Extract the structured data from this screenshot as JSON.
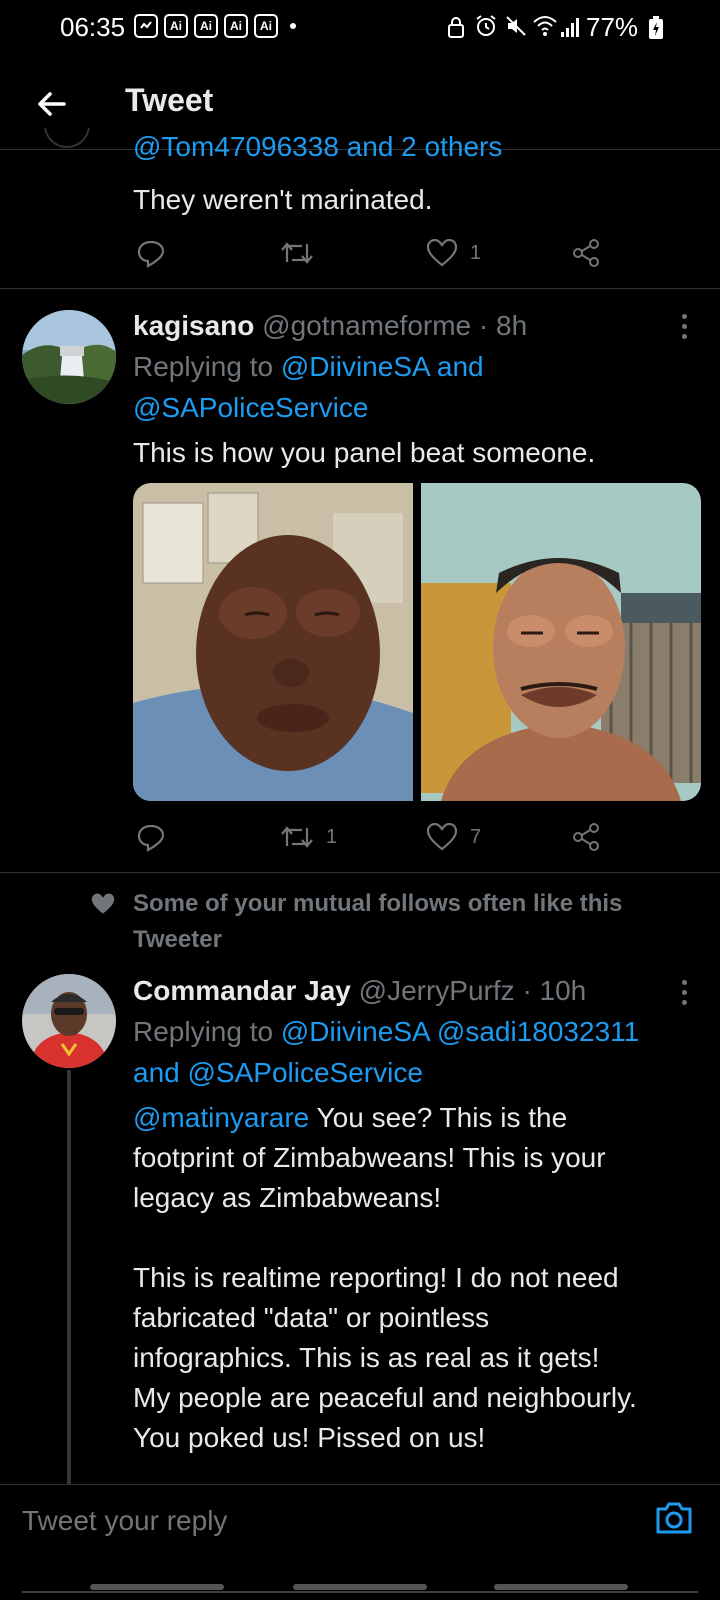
{
  "status_bar": {
    "time": "06:35",
    "notification_badges": [
      "Ai",
      "Ai",
      "Ai",
      "Ai"
    ],
    "battery": "77%"
  },
  "header": {
    "back_icon": "arrow-left-icon",
    "title": "Tweet"
  },
  "tweet1": {
    "mentions": "@Tom47096338 and 2 others",
    "text": "They weren't marinated.",
    "likes": "1"
  },
  "tweet2": {
    "name": "kagisano",
    "handle": "@gotnameforme",
    "time": "· 8h",
    "replying_prefix": "Replying to",
    "replying_line1": "@DiivineSA and",
    "replying_line2": "@SAPoliceService",
    "text": "This is how you panel beat someone.",
    "retweets": "1",
    "likes": "7"
  },
  "social_context": {
    "line1": "Some of your mutual follows often like this",
    "line2": "Tweeter"
  },
  "tweet3": {
    "name": "Commandar Jay",
    "handle": "@JerryPurfz",
    "time": "· 10h",
    "replying_prefix": "Replying to",
    "replying_line1": "@DiivineSA @sadi18032311",
    "replying_line2": "and @SAPoliceService",
    "mention": "@matinyarare",
    "line1": " You see? This is the",
    "line2": "footprint of Zimbabweans! This is your",
    "line3": "legacy as Zimbabweans!",
    "line4": "This is realtime reporting! I do not need",
    "line5": "fabricated \"data\" or pointless",
    "line6": "infographics. This is as real as it gets!",
    "line7": "My people are peaceful and neighbourly.",
    "line8": "You poked us! Pissed on us!"
  },
  "reply_bar": {
    "placeholder": "Tweet your reply"
  },
  "colors": {
    "background": "#000000",
    "accent": "#1d9bf0",
    "secondary_text": "#71767b",
    "primary_text": "#e7e9ea"
  }
}
